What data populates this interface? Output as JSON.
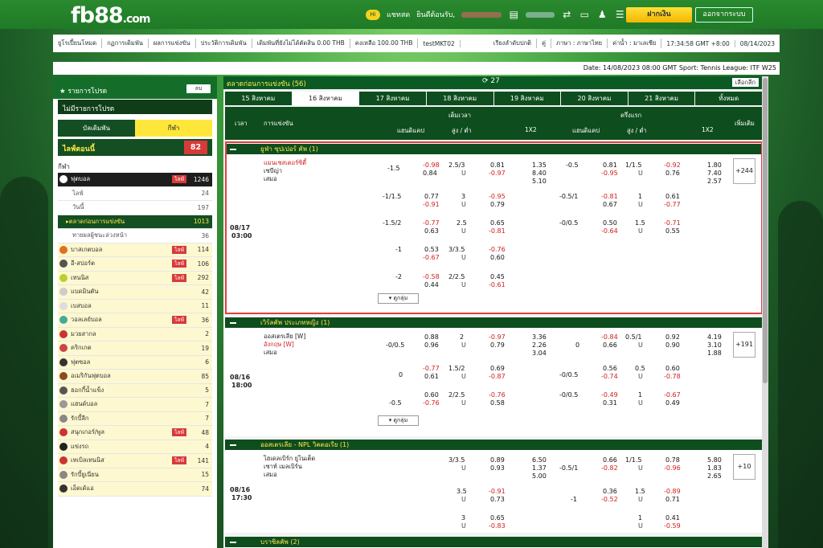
{
  "header": {
    "logo_main": "fb88",
    "logo_sub": ".com",
    "chat": "แชทสด",
    "greet": "ยินดีต้อนรับ,",
    "deposit": "ฝากเงิน",
    "logout": "ออกจากระบบ"
  },
  "nav2": {
    "items": [
      "ยูโรเปี้ยนโหมด",
      "กฏการเดิมพัน",
      "ผลการแข่งขัน",
      "ประวัติการเดิมพัน",
      "เดิมพันที่ยังไม่ได้ตัดสิน 0.00 THB",
      "คงเหลือ 100.00 THB",
      "testMKT02"
    ],
    "right": [
      "เรียงลำดับปกติ",
      "คู่",
      "ภาษา : ภาษาไทย",
      "ค่าน้ำ : มาเลเซีย",
      "17:34:58 GMT +8:00",
      "08/14/2023"
    ]
  },
  "ticker": "Date: 14/08/2023 08:00 GMT Sport: Tennis League: ITF W25",
  "side": {
    "title": "รายการโปรด",
    "sm": "ลบ",
    "no_fav": "ไม่มีรายการโปรด",
    "tab_a": "บัลเดิมพัน",
    "tab_b": "กีฬา",
    "live": "ไลฟ์ตอนนี้",
    "live_count": "82",
    "sport": "กีฬา",
    "items": [
      {
        "t": "ฟุตบอล",
        "n": "1246",
        "lv": "ไลฟ์",
        "cls": "bl",
        "c": "#fff"
      },
      {
        "t": "ไลฟ์",
        "n": "24",
        "cls": "sub"
      },
      {
        "t": "วันนี้",
        "n": "197",
        "cls": "sub"
      },
      {
        "t": "ตลาดก่อนการแข่งขัน",
        "n": "1013",
        "cls": "hl"
      },
      {
        "t": "ทายผลผู้ชนะล่วงหน้า",
        "n": "36",
        "cls": "sub"
      },
      {
        "t": "บาสเกตบอล",
        "n": "114",
        "lv": "ไลฟ์",
        "cls": "y",
        "c": "#e07020"
      },
      {
        "t": "อี-สปอร์ต",
        "n": "106",
        "lv": "ไลฟ์",
        "cls": "y",
        "c": "#555"
      },
      {
        "t": "เทนนิส",
        "n": "292",
        "lv": "ไลฟ์",
        "cls": "y",
        "c": "#b8d030"
      },
      {
        "t": "แบดมินตัน",
        "n": "42",
        "cls": "y",
        "c": "#ccc"
      },
      {
        "t": "เบสบอล",
        "n": "11",
        "cls": "y",
        "c": "#ddd"
      },
      {
        "t": "วอลเลย์บอล",
        "n": "36",
        "lv": "ไลฟ์",
        "cls": "y",
        "c": "#4a9"
      },
      {
        "t": "มวยสากล",
        "n": "2",
        "cls": "y",
        "c": "#c33"
      },
      {
        "t": "คริกเกต",
        "n": "19",
        "cls": "y",
        "c": "#c44"
      },
      {
        "t": "ฟุตซอล",
        "n": "6",
        "cls": "y",
        "c": "#333"
      },
      {
        "t": "อเมริกันฟุตบอล",
        "n": "85",
        "cls": "y",
        "c": "#8a4a22"
      },
      {
        "t": "ฮอกกี้น้ำแข็ง",
        "n": "5",
        "cls": "y",
        "c": "#555"
      },
      {
        "t": "แฮนด์บอล",
        "n": "7",
        "cls": "y",
        "c": "#999"
      },
      {
        "t": "รักบี้ลีก",
        "n": "7",
        "cls": "y",
        "c": "#888"
      },
      {
        "t": "สนุกเกอร์/พูล",
        "n": "48",
        "lv": "ไลฟ์",
        "cls": "y",
        "c": "#c33"
      },
      {
        "t": "แข่งรถ",
        "n": "4",
        "cls": "y",
        "c": "#222"
      },
      {
        "t": "เทเบิลเทนนิส",
        "n": "141",
        "lv": "ไลฟ์",
        "cls": "y",
        "c": "#c33"
      },
      {
        "t": "รักบี้ยูเนี่ยน",
        "n": "15",
        "cls": "y",
        "c": "#888"
      },
      {
        "t": "เอ็ดเด้แอ",
        "n": "74",
        "cls": "y",
        "c": "#333"
      }
    ]
  },
  "main": {
    "head": "ตลาดก่อนการแข่งขัน (56)",
    "refresh": "27",
    "pick": "เลือกลีก",
    "dates": [
      "15 สิงหาคม",
      "16 สิงหาคม",
      "17 สิงหาคม",
      "18 สิงหาคม",
      "19 สิงหาคม",
      "20 สิงหาคม",
      "21 สิงหาคม",
      "ทั้งหมด"
    ],
    "cols": {
      "time": "เวลา",
      "match": "การแข่งขัน",
      "full": "เต็มเวลา",
      "half": "ครึ่งแรก",
      "hdp": "แฮนดิแคป",
      "ou": "สูง / ต่ำ",
      "x12": "1X2",
      "more": "เพิ่มเติม"
    },
    "leagues": [
      "ยูฟ่า ซุปเปอร์ คัพ (1)",
      "เวิร์ลคัพ ประเภทหญิง (1)",
      "ออสเตรเลีย - NPL วิคตอเรีย (1)",
      "บราซิลคัพ (2)"
    ],
    "m1": {
      "date": "08/17",
      "time": "03:00",
      "home": "แมนเชสเตอร์ซิตี้",
      "away": "เซบีญ่า",
      "draw": "เสมอ",
      "plus": "+244",
      "more": "ดูกลุ่ม"
    },
    "m2": {
      "date": "08/16",
      "time": "18:00",
      "home": "ออสเตรเลีย [W]",
      "away": "อังกฤษ [W]",
      "draw": "เสมอ",
      "plus": "+191",
      "more": "ดูกลุ่ม"
    },
    "m3": {
      "date": "08/16",
      "time": "17:30",
      "home": "ไฮเดลเบิร์ก ยูไนเต็ด",
      "away": "เซาท์ เมลเบิร์น",
      "draw": "เสมอ",
      "plus": "+10"
    }
  }
}
